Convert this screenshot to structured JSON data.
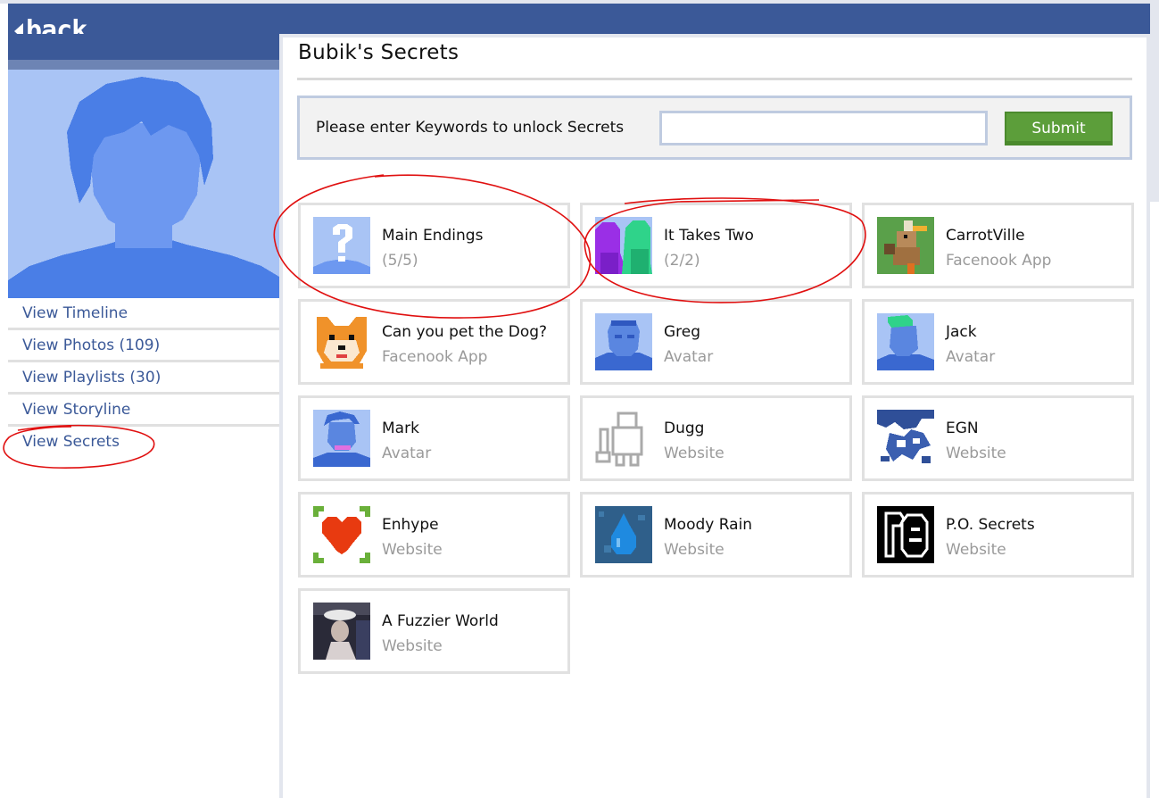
{
  "header": {
    "back_label": "back"
  },
  "nav": {
    "items": [
      {
        "label": "View Timeline"
      },
      {
        "label": "View Photos (109)"
      },
      {
        "label": "View Playlists (30)"
      },
      {
        "label": "View Storyline"
      },
      {
        "label": "View Secrets"
      }
    ]
  },
  "main": {
    "title": "Bubik's Secrets",
    "keyword_prompt": "Please enter Keywords to unlock Secrets",
    "keyword_value": "",
    "submit_label": "Submit"
  },
  "secrets": [
    {
      "name": "Main Endings",
      "sub": "(5/5)",
      "icon": "question-mark-avatar-icon"
    },
    {
      "name": "It Takes Two",
      "sub": "(2/2)",
      "icon": "two-figures-icon"
    },
    {
      "name": "CarrotVille",
      "sub": "Facenook App",
      "icon": "carrot-duck-icon"
    },
    {
      "name": "Can you pet the Dog?",
      "sub": "Facenook App",
      "icon": "shiba-dog-icon"
    },
    {
      "name": "Greg",
      "sub": "Avatar",
      "icon": "greg-avatar-icon"
    },
    {
      "name": "Jack",
      "sub": "Avatar",
      "icon": "jack-avatar-icon"
    },
    {
      "name": "Mark",
      "sub": "Avatar",
      "icon": "mark-avatar-icon"
    },
    {
      "name": "Dugg",
      "sub": "Website",
      "icon": "dugg-robot-icon"
    },
    {
      "name": "EGN",
      "sub": "Website",
      "icon": "egn-logo-icon"
    },
    {
      "name": "Enhype",
      "sub": "Website",
      "icon": "heart-icon"
    },
    {
      "name": "Moody Rain",
      "sub": "Website",
      "icon": "raindrop-icon"
    },
    {
      "name": "P.O. Secrets",
      "sub": "Website",
      "icon": "po-secrets-logo-icon"
    },
    {
      "name": "A Fuzzier World",
      "sub": "Website",
      "icon": "fuzzy-photo-icon"
    }
  ],
  "colors": {
    "brand_blue": "#3b5998",
    "link_blue": "#3b5998",
    "submit_green": "#5c9e3a",
    "annotation_red": "#e01010"
  }
}
